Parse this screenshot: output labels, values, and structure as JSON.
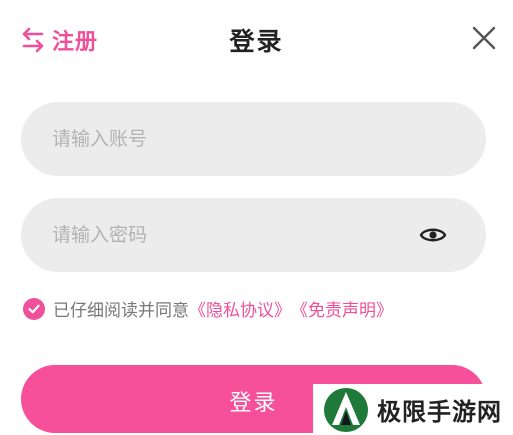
{
  "header": {
    "switch_label": "注册",
    "title": "登录"
  },
  "form": {
    "account_placeholder": "请输入账号",
    "password_placeholder": "请输入密码",
    "agreement_prefix": "已仔细阅读并同意",
    "privacy_link": "《隐私协议》",
    "disclaimer_link": "《免责声明》",
    "agreement_checked": true,
    "submit_label": "登录"
  },
  "watermark": {
    "text": "极限手游网"
  },
  "colors": {
    "accent": "#f0509a",
    "button": "#f7509a",
    "field_bg": "#ececec"
  }
}
